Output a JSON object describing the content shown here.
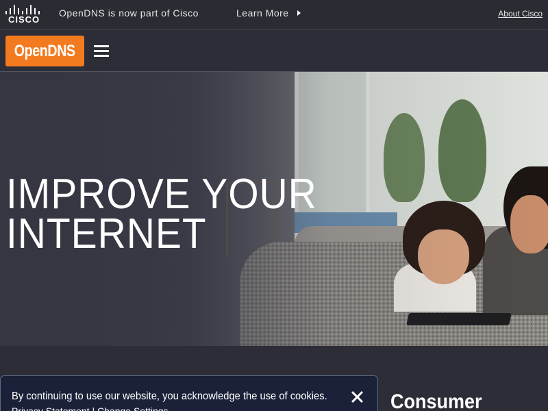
{
  "topbar": {
    "logo_text": "CISCO",
    "message": "OpenDNS is now part of Cisco",
    "learn_more": "Learn More",
    "about_link": "About Cisco"
  },
  "navbar": {
    "brand": "OpenDNS",
    "menu_icon": "hamburger-menu-icon"
  },
  "hero": {
    "title_line1": "IMPROVE YOUR",
    "title_line2": "INTERNET"
  },
  "section": {
    "heading": "Consumer"
  },
  "cookie_banner": {
    "text": "By continuing to use our website, you acknowledge the use of cookies.",
    "privacy_link": "Privacy Statement",
    "separator": "|",
    "settings_link": "Change Settings",
    "close_icon": "close-icon"
  },
  "colors": {
    "brand_orange": "#f47a20",
    "topbar_bg": "#2b2c33",
    "cookie_bg": "#1b2138"
  }
}
